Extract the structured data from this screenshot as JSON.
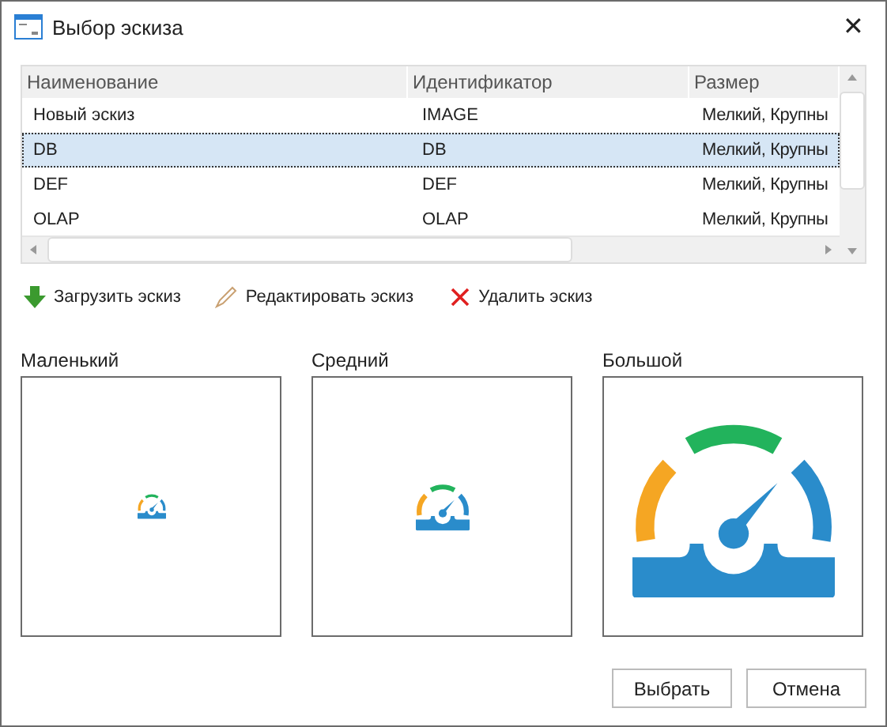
{
  "window": {
    "title": "Выбор эскиза",
    "close": "✕"
  },
  "table": {
    "columns": [
      "Наименование",
      "Идентификатор",
      "Размер"
    ],
    "rows": [
      {
        "cells": [
          "Новый эскиз",
          "IMAGE",
          "Мелкий, Крупны"
        ],
        "selected": false
      },
      {
        "cells": [
          "DB",
          "DB",
          "Мелкий, Крупны"
        ],
        "selected": true
      },
      {
        "cells": [
          "DEF",
          "DEF",
          "Мелкий, Крупны"
        ],
        "selected": false
      },
      {
        "cells": [
          "OLAP",
          "OLAP",
          "Мелкий, Крупны"
        ],
        "selected": false
      }
    ]
  },
  "actions": [
    {
      "kind": "load",
      "label": "Загрузить эскиз"
    },
    {
      "kind": "edit",
      "label": "Редактировать эскиз"
    },
    {
      "kind": "delete",
      "label": "Удалить эскиз"
    }
  ],
  "previews": [
    {
      "label": "Маленький"
    },
    {
      "label": "Средний"
    },
    {
      "label": "Большой"
    }
  ],
  "buttons": [
    "Выбрать",
    "Отмена"
  ]
}
